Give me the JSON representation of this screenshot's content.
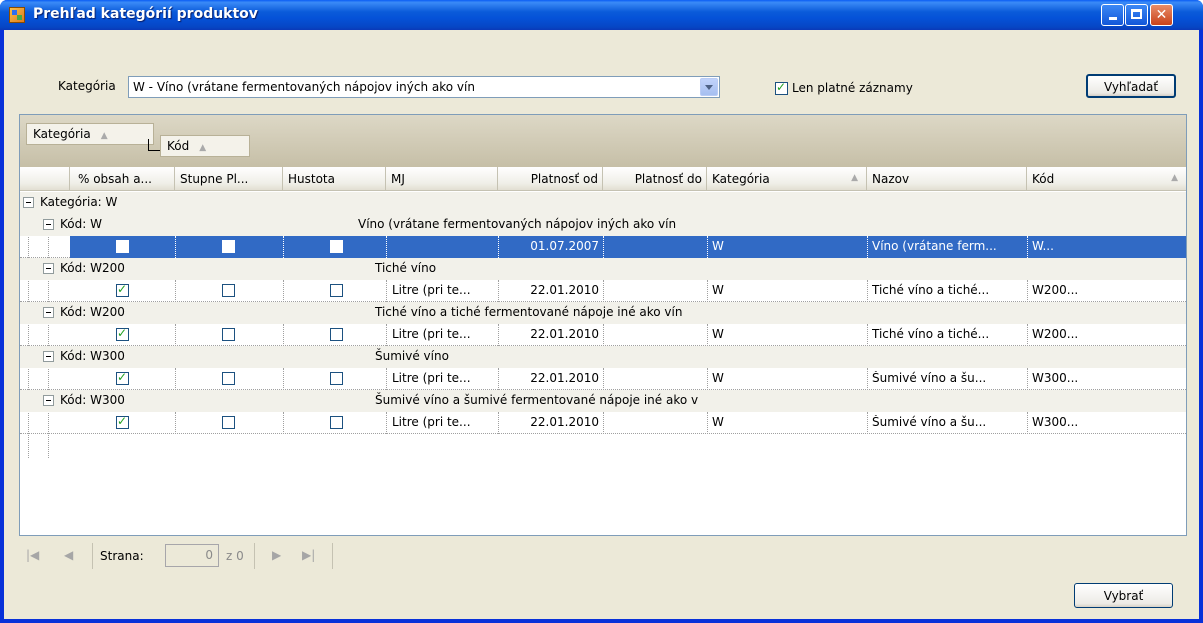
{
  "window": {
    "title": "Prehľad kategórií produktov"
  },
  "filter": {
    "kategoria_label": "Kategória",
    "kategoria_value": "W - Víno (vrátane fermentovaných nápojov iných ako vín",
    "only_valid_label": "Len platné záznamy",
    "only_valid_checked": true,
    "search_button": "Vyhľadať"
  },
  "grid": {
    "group_by": [
      "Kategória",
      "Kód"
    ],
    "columns": [
      "% obsah a...",
      "Stupne Pl...",
      "Hustota",
      "MJ",
      "Platnosť od",
      "Platnosť do",
      "Kategória",
      "Nazov",
      "Kód"
    ],
    "top_group": {
      "caption": "Kategória:  W"
    },
    "groups": [
      {
        "caption": "Kód: W",
        "desc": "Víno (vrátane fermentovaných nápojov iných ako vín",
        "row": {
          "obsah": false,
          "stupne": false,
          "hustota": false,
          "mj": "",
          "platnost_od": "01.07.2007",
          "platnost_do": "",
          "kategoria": "W",
          "nazov": "Víno (vrátane ferm...",
          "kod": "W...",
          "selected": true
        }
      },
      {
        "caption": "Kód: W200",
        "desc": "Tiché víno",
        "row": {
          "obsah": true,
          "stupne": false,
          "hustota": false,
          "mj": "Litre (pri te...",
          "platnost_od": "22.01.2010",
          "platnost_do": "",
          "kategoria": "W",
          "nazov": "Tiché víno a tiché...",
          "kod": "W200...",
          "selected": false
        }
      },
      {
        "caption": "Kód: W200",
        "desc": "Tiché víno a tiché fermentované nápoje iné ako vín",
        "row": {
          "obsah": true,
          "stupne": false,
          "hustota": false,
          "mj": "Litre (pri te...",
          "platnost_od": "22.01.2010",
          "platnost_do": "",
          "kategoria": "W",
          "nazov": "Tiché víno a tiché...",
          "kod": "W200...",
          "selected": false
        }
      },
      {
        "caption": "Kód: W300",
        "desc": "Šumivé víno",
        "row": {
          "obsah": true,
          "stupne": false,
          "hustota": false,
          "mj": "Litre (pri te...",
          "platnost_od": "22.01.2010",
          "platnost_do": "",
          "kategoria": "W",
          "nazov": "Šumivé víno a šu...",
          "kod": "W300...",
          "selected": false
        }
      },
      {
        "caption": "Kód: W300",
        "desc": "Šumivé víno a šumivé fermentované nápoje iné ako v",
        "row": {
          "obsah": true,
          "stupne": false,
          "hustota": false,
          "mj": "Litre (pri te...",
          "platnost_od": "22.01.2010",
          "platnost_do": "",
          "kategoria": "W",
          "nazov": "Šumivé víno a šu...",
          "kod": "W300...",
          "selected": false
        }
      }
    ]
  },
  "pager": {
    "page_label": "Strana:",
    "page_value": "0",
    "page_total": "z 0"
  },
  "footer": {
    "select_button": "Vybrať"
  },
  "colors": {
    "selection": "#316ac5",
    "title_bar": "#0a5bd9",
    "window_bg": "#ece9d8"
  }
}
